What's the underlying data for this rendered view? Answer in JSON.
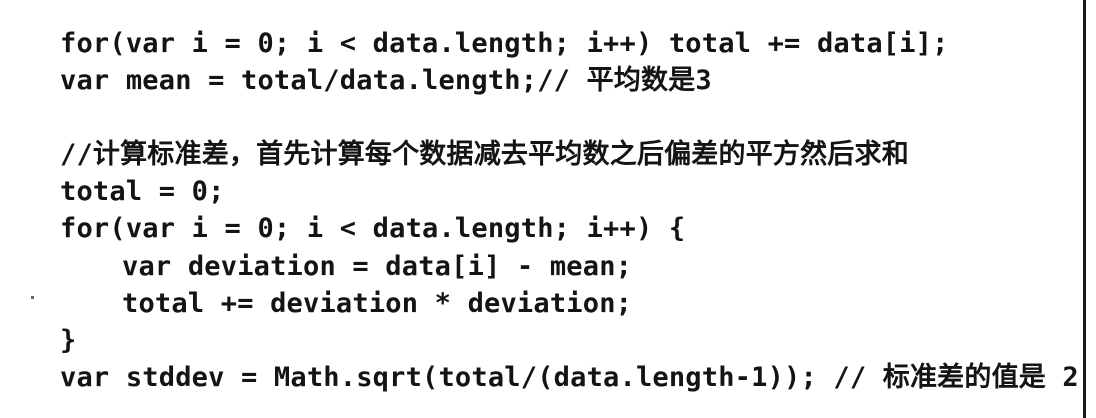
{
  "code_lines": [
    "for(var i = 0; i < data.length; i++) total += data[i];",
    "var mean = total/data.length;// 平均数是3",
    "",
    "//计算标准差，首先计算每个数据减去平均数之后偏差的平方然后求和",
    "total = 0;",
    "for(var i = 0; i < data.length; i++) {",
    "var deviation = data[i] - mean;",
    "total += deviation * deviation;",
    "}",
    "var stddev = Math.sqrt(total/(data.length-1)); // 标准差的值是 2"
  ]
}
